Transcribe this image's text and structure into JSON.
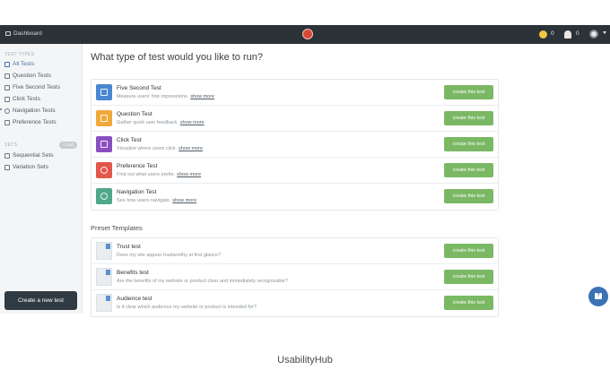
{
  "topbar": {
    "dashboard_label": "Dashboard",
    "coin_count": "0",
    "notif_count": "0",
    "brand_color": "#d9473b"
  },
  "sidebar": {
    "test_types_header": "TEST TYPES",
    "items": [
      {
        "label": "All Tests",
        "icon": "grid-icon"
      },
      {
        "label": "Question Tests",
        "icon": "speech-bubble-icon"
      },
      {
        "label": "Five Second Tests",
        "icon": "hourglass-icon"
      },
      {
        "label": "Click Tests",
        "icon": "cursor-icon"
      },
      {
        "label": "Navigation Tests",
        "icon": "compass-icon"
      },
      {
        "label": "Preference Tests",
        "icon": "heart-icon"
      }
    ],
    "sets_header": "SETS",
    "add_label": "+ Add",
    "sets": [
      {
        "label": "Sequential Sets",
        "icon": "stack-icon"
      },
      {
        "label": "Variation Sets",
        "icon": "copy-icon"
      }
    ],
    "new_test_button": "Create a new test"
  },
  "main": {
    "title": "What type of test would you like to run?",
    "test_types": [
      {
        "name": "Five Second Test",
        "description": "Measure users' first impressions.",
        "more": "show more",
        "button": "create this test",
        "color": "#4a87d0",
        "icon": "hourglass-icon"
      },
      {
        "name": "Question Test",
        "description": "Gather quick user feedback.",
        "more": "show more",
        "button": "create this test",
        "color": "#f0a93b",
        "icon": "speech-bubble-icon"
      },
      {
        "name": "Click Test",
        "description": "Visualize where users click.",
        "more": "show more",
        "button": "create this test",
        "color": "#8a4fc1",
        "icon": "cursor-icon"
      },
      {
        "name": "Preference Test",
        "description": "Find out what users prefer.",
        "more": "show more",
        "button": "create this test",
        "color": "#e3574b",
        "icon": "heart-icon"
      },
      {
        "name": "Navigation Test",
        "description": "See how users navigate.",
        "more": "show more",
        "button": "create this test",
        "color": "#4fa889",
        "icon": "compass-icon"
      }
    ],
    "preset_title": "Preset Templates",
    "presets": [
      {
        "name": "Trust test",
        "description": "Does my site appear trustworthy at first glance?",
        "button": "create this test"
      },
      {
        "name": "Benefits test",
        "description": "Are the benefits of my website or product clear and immediately recognizable?",
        "button": "create this test"
      },
      {
        "name": "Audience test",
        "description": "Is it clear which audience my website or product is intended for?",
        "button": "create this test"
      }
    ],
    "accent_button_color": "#7ab864"
  },
  "help_button_label": "?",
  "caption": "UsabilityHub"
}
